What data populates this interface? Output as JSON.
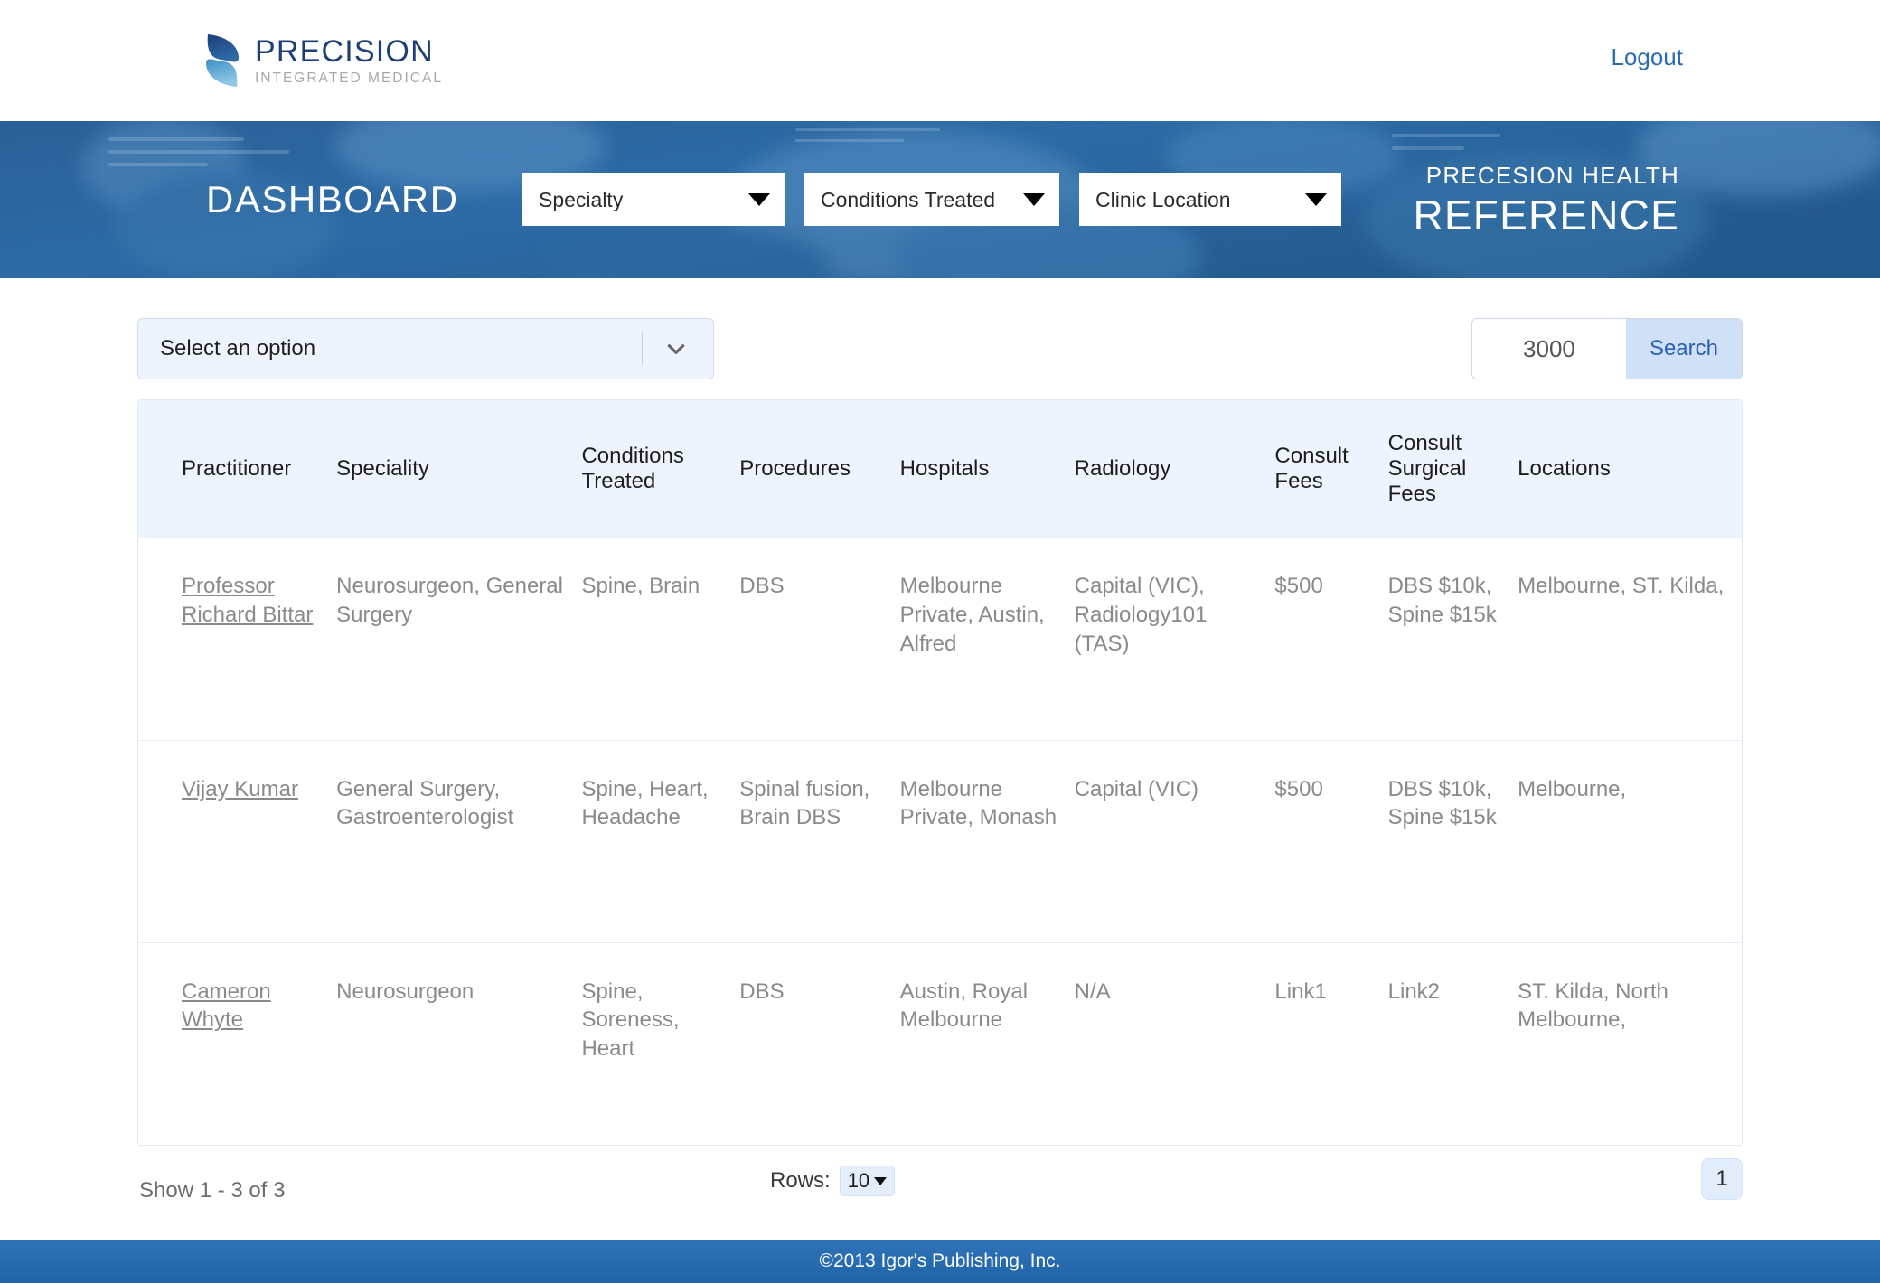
{
  "topbar": {
    "logo_title": "PRECISION",
    "logo_subtitle": "INTEGRATED MEDICAL",
    "logo_icon": "precision-ribbon-logo",
    "logout_label": "Logout"
  },
  "banner": {
    "dashboard_title": "DASHBOARD",
    "brand_line1": "PRECESION HEALTH",
    "brand_line2": "REFERENCE",
    "selects": [
      {
        "name": "specialty",
        "label": "Specialty",
        "icon": "triangle-down-icon"
      },
      {
        "name": "conditions-treated",
        "label": "Conditions Treated",
        "icon": "triangle-down-icon"
      },
      {
        "name": "clinic-location",
        "label": "Clinic Location",
        "icon": "triangle-down-icon"
      }
    ]
  },
  "controls": {
    "option_select_label": "Select an option",
    "option_select_icon": "chevron-down-icon",
    "search_value": "3000",
    "search_placeholder": "3000",
    "search_button_label": "Search"
  },
  "table": {
    "headers": [
      "Practitioner",
      "Speciality",
      "Conditions Treated",
      "Procedures",
      "Hospitals",
      "Radiology",
      "Consult Fees",
      "Consult Surgical Fees",
      "Locations"
    ],
    "rows": [
      {
        "practitioner": "Professor Richard Bittar",
        "speciality": "Neurosurgeon, General Surgery",
        "conditions": "Spine, Brain",
        "procedures": "DBS",
        "hospitals": "Melbourne Private, Austin, Alfred",
        "radiology": "Capital (VIC), Radiology101 (TAS)",
        "consult_fees": "$500",
        "consult_surgical_fees": "DBS $10k, Spine $15k",
        "locations": "Melbourne, ST. Kilda,"
      },
      {
        "practitioner": "Vijay Kumar",
        "speciality": "General Surgery, Gastroenterologist",
        "conditions": "Spine, Heart, Headache",
        "procedures": "Spinal fusion, Brain DBS",
        "hospitals": "Melbourne Private, Monash",
        "radiology": "Capital (VIC)",
        "consult_fees": "$500",
        "consult_surgical_fees": "DBS $10k, Spine $15k",
        "locations": "Melbourne,"
      },
      {
        "practitioner": "Cameron Whyte",
        "speciality": "Neurosurgeon",
        "conditions": "Spine, Soreness, Heart",
        "procedures": "DBS",
        "hospitals": "Austin, Royal Melbourne",
        "radiology": "N/A",
        "consult_fees": "Link1",
        "consult_surgical_fees": "Link2",
        "locations": "ST. Kilda, North Melbourne,"
      }
    ]
  },
  "pagination": {
    "show_text": "Show 1 - 3 of 3",
    "rows_label": "Rows:",
    "rows_value": "10",
    "rows_icon": "chevron-down-icon",
    "page_number": "1"
  },
  "footer": {
    "copyright": "©2013 Igor's Publishing, Inc."
  },
  "colors": {
    "brand_navy": "#1c3f78",
    "banner_blue": "#2a6098",
    "link_blue": "#2a6cb5",
    "accent_light": "#eef4fd",
    "footer_blue": "#2065a8"
  }
}
